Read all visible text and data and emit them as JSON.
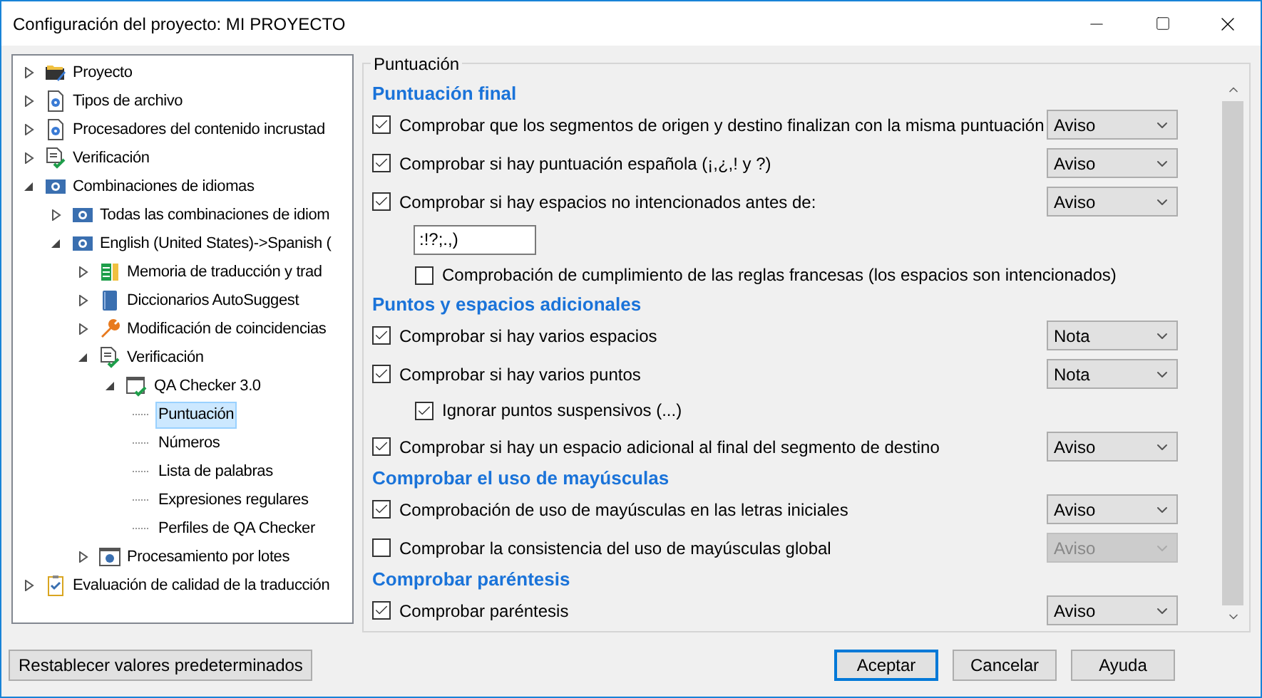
{
  "window": {
    "title": "Configuración del proyecto: MI PROYECTO"
  },
  "tree": [
    {
      "label": "Proyecto",
      "kind": "project",
      "expanded": false,
      "selected": false
    },
    {
      "label": "Tipos de archivo",
      "kind": "settings",
      "expanded": false,
      "selected": false
    },
    {
      "label": "Procesadores del contenido incrustad",
      "kind": "settings",
      "expanded": false,
      "selected": false
    },
    {
      "label": "Verificación",
      "kind": "verification",
      "expanded": false,
      "selected": false
    },
    {
      "label": "Combinaciones de idiomas",
      "kind": "language",
      "expanded": true,
      "selected": false,
      "children": [
        {
          "label": "Todas las combinaciones de idiom",
          "kind": "language",
          "expanded": false,
          "selected": false
        },
        {
          "label": "English (United States)->Spanish (",
          "kind": "language",
          "expanded": true,
          "selected": false,
          "children": [
            {
              "label": "Memoria de traducción y trad",
              "kind": "memory",
              "expanded": false,
              "selected": false
            },
            {
              "label": "Diccionarios AutoSuggest",
              "kind": "dictionary",
              "expanded": false,
              "selected": false
            },
            {
              "label": "Modificación de coincidencias",
              "kind": "wrench",
              "expanded": false,
              "selected": false
            },
            {
              "label": "Verificación",
              "kind": "verification",
              "expanded": true,
              "selected": false,
              "children": [
                {
                  "label": "QA Checker 3.0",
                  "kind": "checker",
                  "expanded": true,
                  "selected": false,
                  "children": [
                    {
                      "label": "Puntuación",
                      "kind": "page",
                      "selected": true
                    },
                    {
                      "label": "Números",
                      "kind": "page",
                      "selected": false
                    },
                    {
                      "label": "Lista de palabras",
                      "kind": "page",
                      "selected": false
                    },
                    {
                      "label": "Expresiones regulares",
                      "kind": "page",
                      "selected": false
                    },
                    {
                      "label": "Perfiles de QA Checker",
                      "kind": "page",
                      "selected": false
                    }
                  ]
                }
              ]
            },
            {
              "label": "Procesamiento por lotes",
              "kind": "batch",
              "expanded": false,
              "selected": false
            }
          ]
        }
      ]
    },
    {
      "label": "Evaluación de calidad de la traducción",
      "kind": "quality",
      "expanded": false,
      "selected": false
    }
  ],
  "panel": {
    "title": "Puntuación",
    "sections": [
      {
        "title": "Puntuación final",
        "rows": [
          {
            "kind": "check",
            "label": "Comprobar que los segmentos de origen y destino finalizan con la misma puntuación",
            "checked": true,
            "severity": "Aviso",
            "severity_disabled": false
          },
          {
            "kind": "check",
            "label": "Comprobar si hay puntuación española (¡,¿,! y ?)",
            "checked": true,
            "severity": "Aviso",
            "severity_disabled": false
          },
          {
            "kind": "check",
            "label": "Comprobar si hay espacios no intencionados antes de:",
            "checked": true,
            "severity": "Aviso",
            "severity_disabled": false,
            "children": [
              {
                "kind": "field",
                "value": ":!?;.,)"
              },
              {
                "kind": "check",
                "label": "Comprobación de cumplimiento de las reglas francesas (los espacios son intencionados)",
                "checked": false
              }
            ]
          }
        ]
      },
      {
        "title": "Puntos y espacios adicionales",
        "rows": [
          {
            "kind": "check",
            "label": "Comprobar si hay varios espacios",
            "checked": true,
            "severity": "Nota",
            "severity_disabled": false
          },
          {
            "kind": "check",
            "label": "Comprobar si hay varios puntos",
            "checked": true,
            "severity": "Nota",
            "severity_disabled": false,
            "children": [
              {
                "kind": "check",
                "label": "Ignorar puntos suspensivos (...)",
                "checked": true
              }
            ]
          },
          {
            "kind": "check",
            "label": "Comprobar si hay un espacio adicional al final del segmento de destino",
            "checked": true,
            "severity": "Aviso",
            "severity_disabled": false
          }
        ]
      },
      {
        "title": "Comprobar el uso de mayúsculas",
        "rows": [
          {
            "kind": "check",
            "label": "Comprobación de uso de mayúsculas en las letras iniciales",
            "checked": true,
            "severity": "Aviso",
            "severity_disabled": false
          },
          {
            "kind": "check",
            "label": "Comprobar la consistencia del uso de mayúsculas global",
            "checked": false,
            "severity": "Aviso",
            "severity_disabled": true
          }
        ]
      },
      {
        "title": "Comprobar paréntesis",
        "rows": [
          {
            "kind": "check",
            "label": "Comprobar paréntesis",
            "checked": true,
            "severity": "Aviso",
            "severity_disabled": false
          }
        ]
      }
    ]
  },
  "buttons": [
    {
      "label": "Restablecer valores predeterminados",
      "kind": "reset"
    },
    {
      "label": "Aceptar",
      "kind": "default"
    },
    {
      "label": "Cancelar",
      "kind": "normal"
    },
    {
      "label": "Ayuda",
      "kind": "normal"
    }
  ]
}
